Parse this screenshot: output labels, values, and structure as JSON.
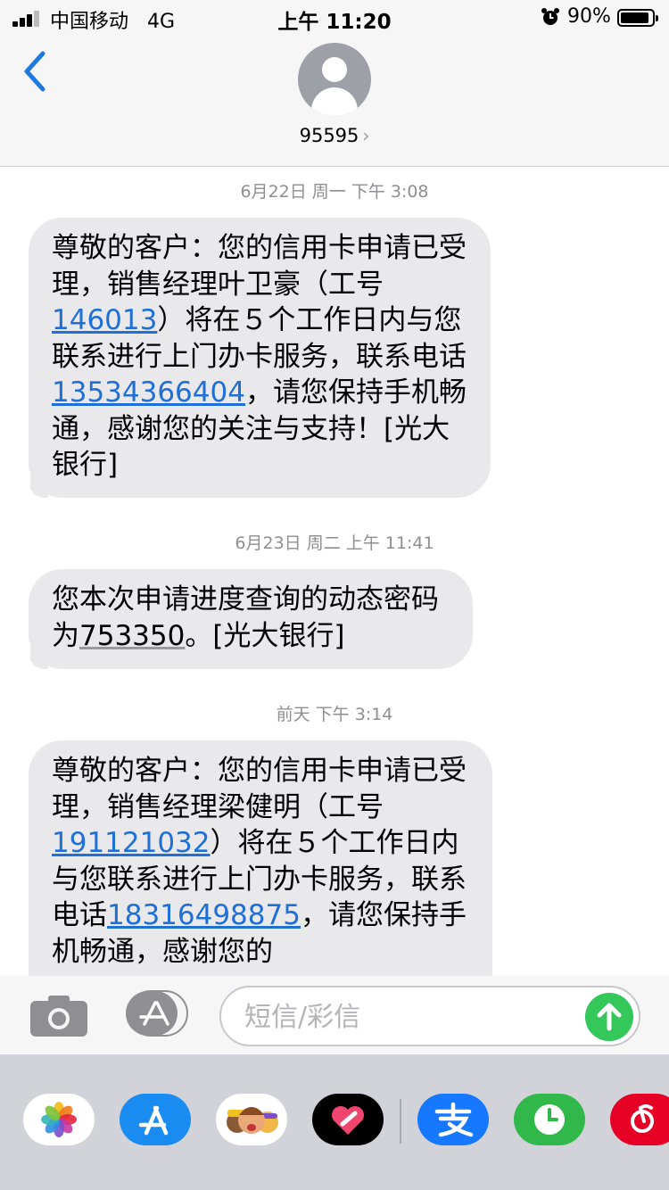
{
  "status_bar": {
    "carrier": "中国移动",
    "network": "4G",
    "time": "上午 11:20",
    "battery_percent": "90%",
    "battery_level": 0.9
  },
  "header": {
    "contact": "95595",
    "back_icon": "chevron-left-icon",
    "avatar_icon": "person-icon"
  },
  "messages": [
    {
      "date": "6月22日 周一 下午 3:08",
      "segments": [
        {
          "text": "尊敬的客户：您的信用卡申请已受理，销售经理叶卫豪（工号"
        },
        {
          "text": "146013",
          "type": "link"
        },
        {
          "text": "）将在５个工作日内与您联系进行上门办卡服务，联系电话"
        },
        {
          "text": "13534366404",
          "type": "link"
        },
        {
          "text": "，请您保持手机畅通，感谢您的关注与支持！[光大银行]"
        }
      ]
    },
    {
      "date": "6月23日 周二 上午 11:41",
      "segments": [
        {
          "text": "您本次申请进度查询的动态密码为"
        },
        {
          "text": "753350",
          "type": "code"
        },
        {
          "text": "。[光大银行]"
        }
      ]
    },
    {
      "date": "前天 下午 3:14",
      "segments": [
        {
          "text": "尊敬的客户：您的信用卡申请已受理，销售经理梁健明（工号"
        },
        {
          "text": "191121032",
          "type": "link"
        },
        {
          "text": "）将在５个工作日内与您联系进行上门办卡服务，联系电话"
        },
        {
          "text": "18316498875",
          "type": "link"
        },
        {
          "text": "，请您保持手机畅通，感谢您的"
        }
      ]
    }
  ],
  "input": {
    "placeholder": "短信/彩信",
    "value": ""
  },
  "colors": {
    "link": "#1f6fd6",
    "bubble": "#e9e9eb",
    "send": "#34c759"
  },
  "app_drawer": [
    "photos-icon",
    "app-store-icon",
    "memoji-icon",
    "digital-touch-icon",
    "alipay-icon",
    "clock-app-icon",
    "netease-music-icon"
  ]
}
